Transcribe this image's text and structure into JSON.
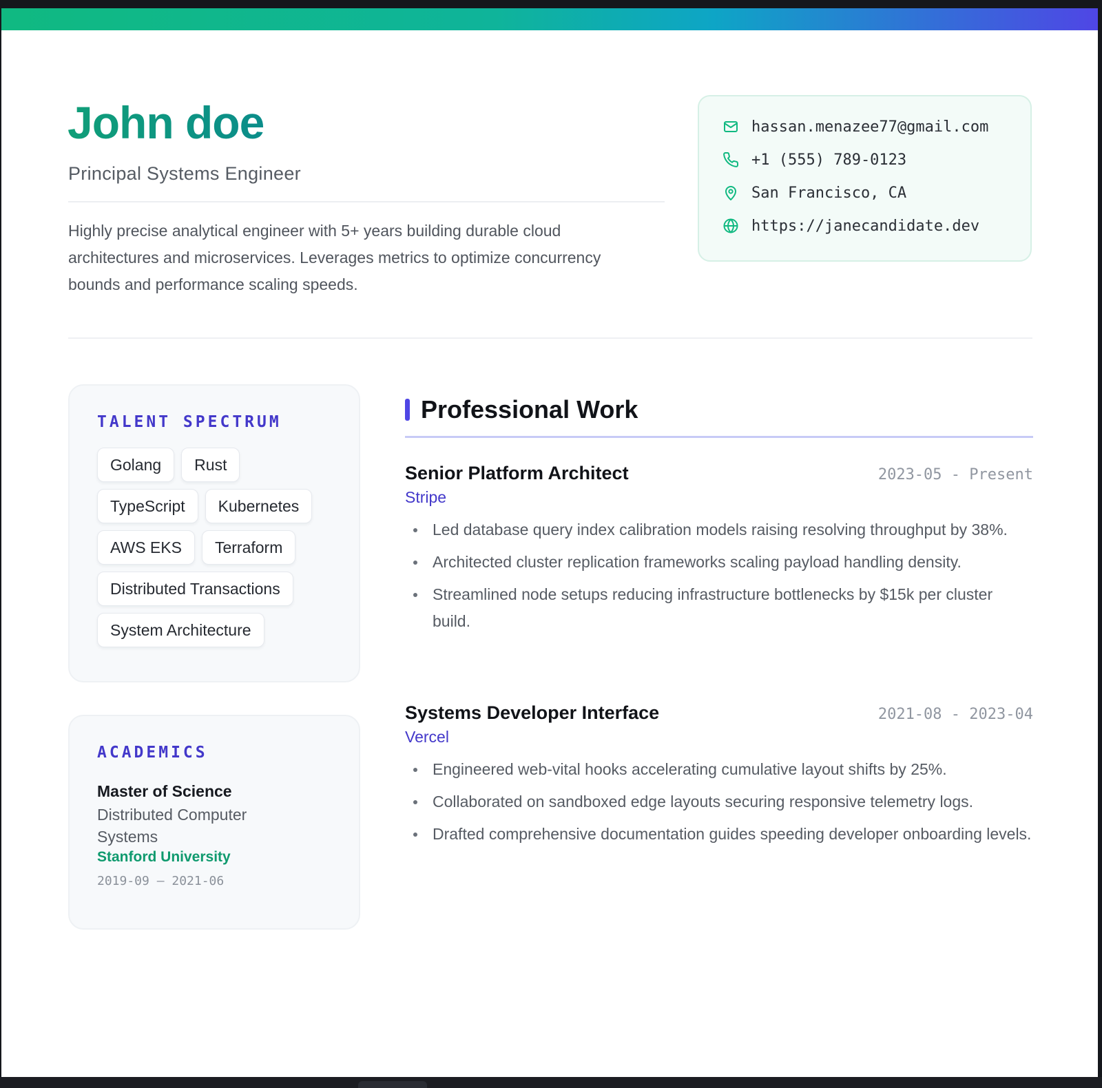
{
  "header": {
    "name": "John doe",
    "title": "Principal Systems Engineer",
    "summary": "Highly precise analytical engineer with 5+ years building durable cloud architectures and microservices. Leverages metrics to optimize concurrency bounds and performance scaling speeds."
  },
  "contact": {
    "email": "hassan.menazee77@gmail.com",
    "phone": "+1 (555) 789-0123",
    "location": "San Francisco, CA",
    "website": "https://janecandidate.dev",
    "icons": [
      "mail-icon",
      "phone-icon",
      "map-pin-icon",
      "globe-icon"
    ],
    "icon_color": "#10b981"
  },
  "skills": {
    "heading": "TALENT SPECTRUM",
    "tags": [
      "Golang",
      "Rust",
      "TypeScript",
      "Kubernetes",
      "AWS EKS",
      "Terraform",
      "Distributed Transactions",
      "System Architecture"
    ]
  },
  "education": {
    "heading": "ACADEMICS",
    "degree": "Master of Science",
    "field": "Distributed Computer Systems",
    "school": "Stanford University",
    "dates": "2019-09 — 2021-06"
  },
  "work": {
    "heading": "Professional Work",
    "jobs": [
      {
        "role": "Senior Platform Architect",
        "company": "Stripe",
        "dates": "2023-05 - Present",
        "bullets": [
          "Led database query index calibration models raising resolving throughput by 38%.",
          "Architected cluster replication frameworks scaling payload handling density.",
          "Streamlined node setups reducing infrastructure bottlenecks by $15k per cluster build."
        ]
      },
      {
        "role": "Systems Developer Interface",
        "company": "Vercel",
        "dates": "2021-08 - 2023-04",
        "bullets": [
          "Engineered web-vital hooks accelerating cumulative layout shifts by 25%.",
          "Collaborated on sandboxed edge layouts securing responsive telemetry logs.",
          "Drafted comprehensive documentation guides speeding developer onboarding levels."
        ]
      }
    ]
  },
  "colors": {
    "accent_green": "#10b981",
    "accent_indigo": "#4f46e5",
    "name_green": "#0f9a74"
  }
}
